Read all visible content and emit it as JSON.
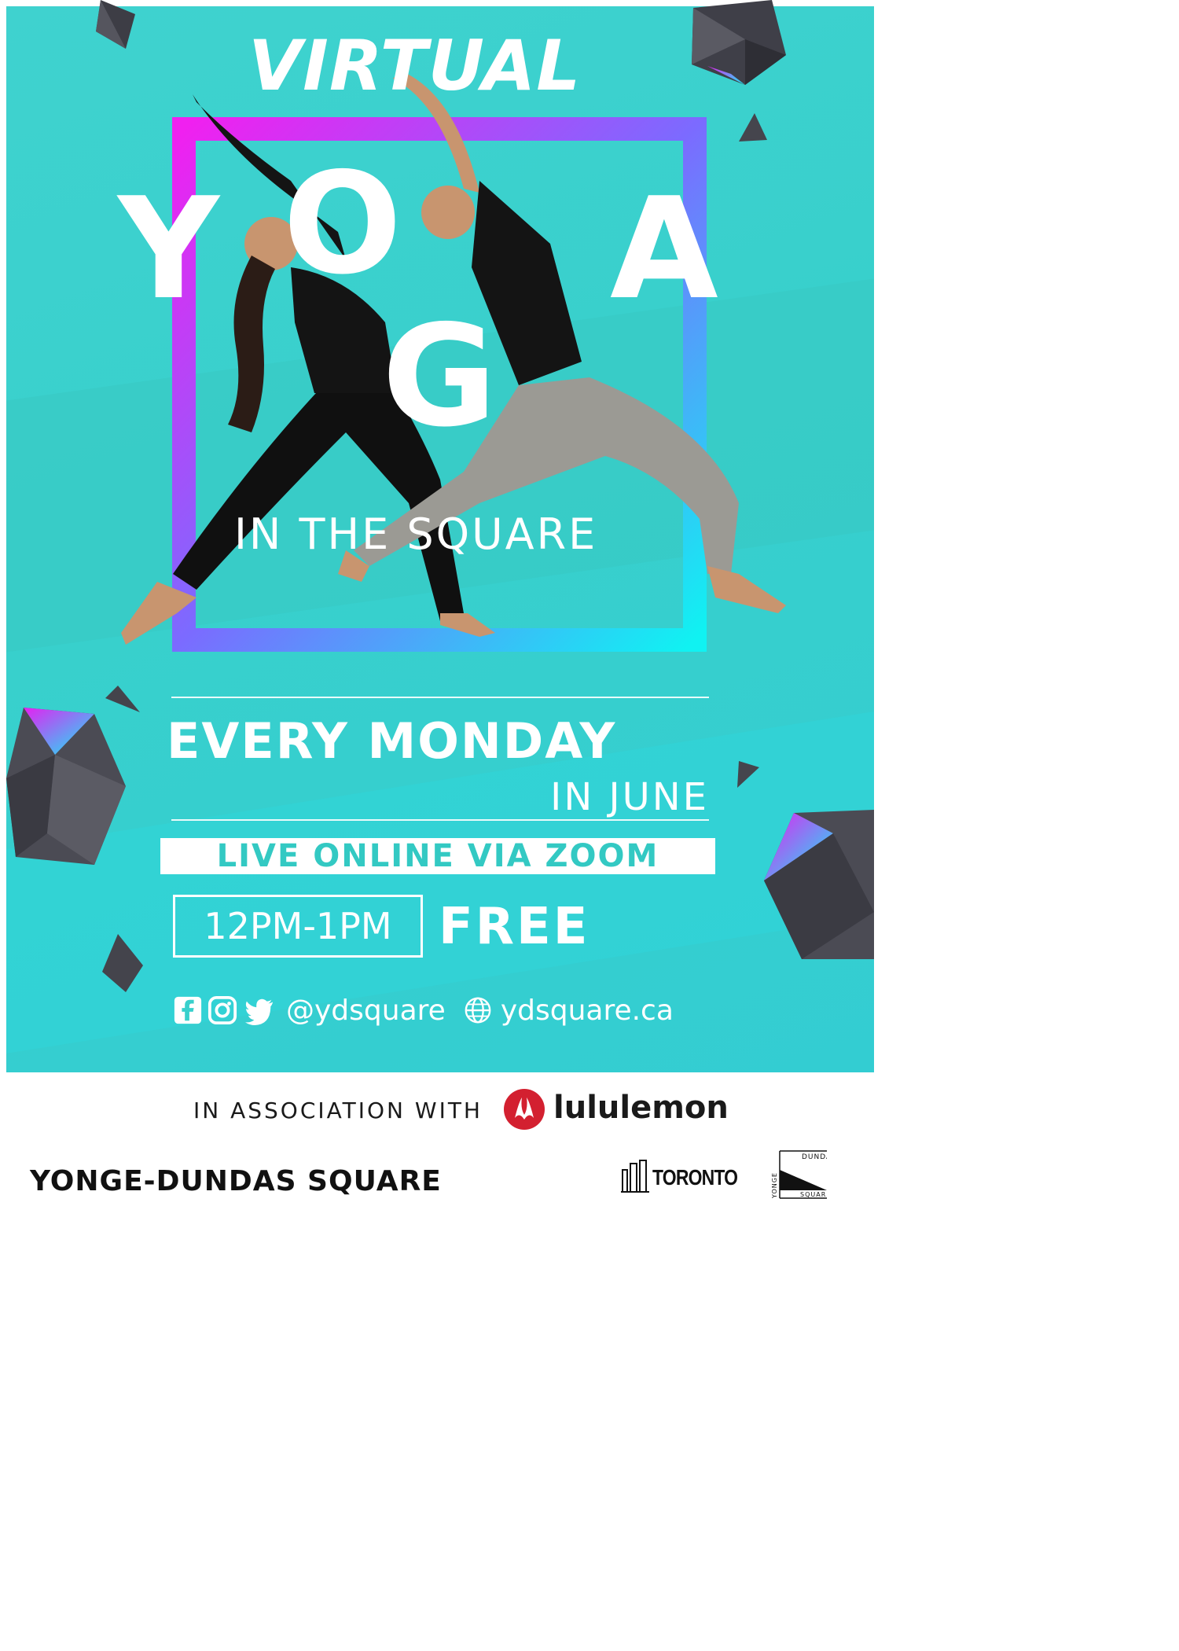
{
  "headline": {
    "top_word": "VIRTUAL",
    "main_letters": [
      "Y",
      "O",
      "G",
      "A"
    ],
    "subline": "IN THE SQUARE"
  },
  "schedule": {
    "days": "EVERY MONDAY",
    "month": "IN JUNE",
    "platform": "LIVE ONLINE VIA ZOOM",
    "time": "12PM-1PM",
    "price": "FREE"
  },
  "social": {
    "icons": [
      "facebook-icon",
      "instagram-icon",
      "twitter-icon",
      "globe-icon"
    ],
    "handle": "@ydsquare",
    "website": "ydsquare.ca"
  },
  "footer": {
    "association": "IN ASSOCIATION WITH",
    "sponsor": "lululemon",
    "venue": "YONGE-DUNDAS SQUARE",
    "city": "TORONTO",
    "logo_words": [
      "DUNDAS",
      "YONGE",
      "SQUARE"
    ]
  },
  "colors": {
    "teal": "#38d0cc",
    "white": "#ffffff",
    "magenta": "#e61ff2",
    "cyan": "#12f0f5",
    "dark_shape": "#4a4a52",
    "lululemon_red": "#d32030"
  }
}
